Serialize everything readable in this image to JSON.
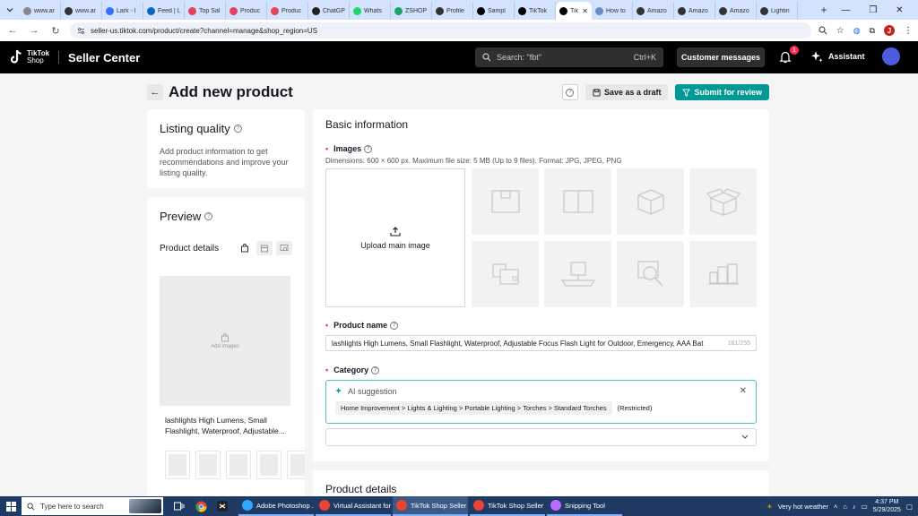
{
  "browser": {
    "tabs": [
      {
        "title": "www.ar",
        "color": "#888888"
      },
      {
        "title": "www.ar",
        "color": "#333333"
      },
      {
        "title": "Lark - l",
        "color": "#3370ff"
      },
      {
        "title": "Feed | L",
        "color": "#0a66c2"
      },
      {
        "title": "Top Sal",
        "color": "#e2445c"
      },
      {
        "title": "Produc",
        "color": "#e2445c"
      },
      {
        "title": "Produc",
        "color": "#e2445c"
      },
      {
        "title": "ChatGP",
        "color": "#222222"
      },
      {
        "title": "Whats",
        "color": "#25d366"
      },
      {
        "title": "ZSHOP",
        "color": "#1fa463"
      },
      {
        "title": "Profile",
        "color": "#333333"
      },
      {
        "title": "Sampl",
        "color": "#000000"
      },
      {
        "title": "TikTok",
        "color": "#000000"
      },
      {
        "title": "Tik",
        "color": "#000000",
        "active": true
      },
      {
        "title": "How to",
        "color": "#6c8ebf"
      },
      {
        "title": "Amazo",
        "color": "#333333"
      },
      {
        "title": "Amazo",
        "color": "#333333"
      },
      {
        "title": "Amazo",
        "color": "#333333"
      },
      {
        "title": "Lightin",
        "color": "#333333"
      }
    ],
    "url": "seller-us.tiktok.com/product/create?channel=manage&shop_region=US",
    "profile_initial": "J"
  },
  "header": {
    "logo_line1": "TikTok",
    "logo_line2": "Shop",
    "brand": "Seller Center",
    "search_placeholder": "Search: \"fbt\"",
    "search_shortcut": "Ctrl+K",
    "customer_messages": "Customer messages",
    "notification_count": "1",
    "assistant": "Assistant"
  },
  "page": {
    "title": "Add new product",
    "save_draft": "Save as a draft",
    "submit": "Submit for review"
  },
  "listing_quality": {
    "title": "Listing quality",
    "description": "Add product information to get recommendations and improve your listing quality."
  },
  "preview": {
    "title": "Preview",
    "product_details": "Product details",
    "add_images": "Add images",
    "product_name": "lashlights High Lumens, Small Flashlight, Waterproof, Adjustable..."
  },
  "basic_info": {
    "title": "Basic information",
    "images_label": "Images",
    "images_hint": "Dimensions: 600 × 600 px. Maximum file size: 5 MB (Up to 9 files). Format: JPG, JPEG, PNG",
    "upload_main": "Upload main image",
    "product_name_label": "Product name",
    "product_name_value": "lashlights High Lumens, Small Flashlight, Waterproof, Adjustable Focus Flash Light for Outdoor, Emergency, AAA Bat",
    "product_name_count": "161/255",
    "category_label": "Category",
    "ai_suggestion": "AI suggestion",
    "category_path": "Home Improvement > Lights & Lighting > Portable Lighting > Torches > Standard Torches",
    "restricted": "(Restricted)"
  },
  "product_details": {
    "title": "Product details"
  },
  "taskbar": {
    "search_placeholder": "Type here to search",
    "apps": [
      {
        "title": "Adobe Photoshop ...",
        "color": "#31a8ff"
      },
      {
        "title": "Virtual Assistant for...",
        "color": "#ea4335"
      },
      {
        "title": "TikTok Shop Seller ...",
        "color": "#ea4335",
        "active": true
      },
      {
        "title": "TikTok Shop Seller ...",
        "color": "#ea4335"
      },
      {
        "title": "Snipping Tool",
        "color": "#b86bff"
      }
    ],
    "weather": "Very hot weather",
    "time": "4:37 PM",
    "date": "5/29/2025"
  }
}
